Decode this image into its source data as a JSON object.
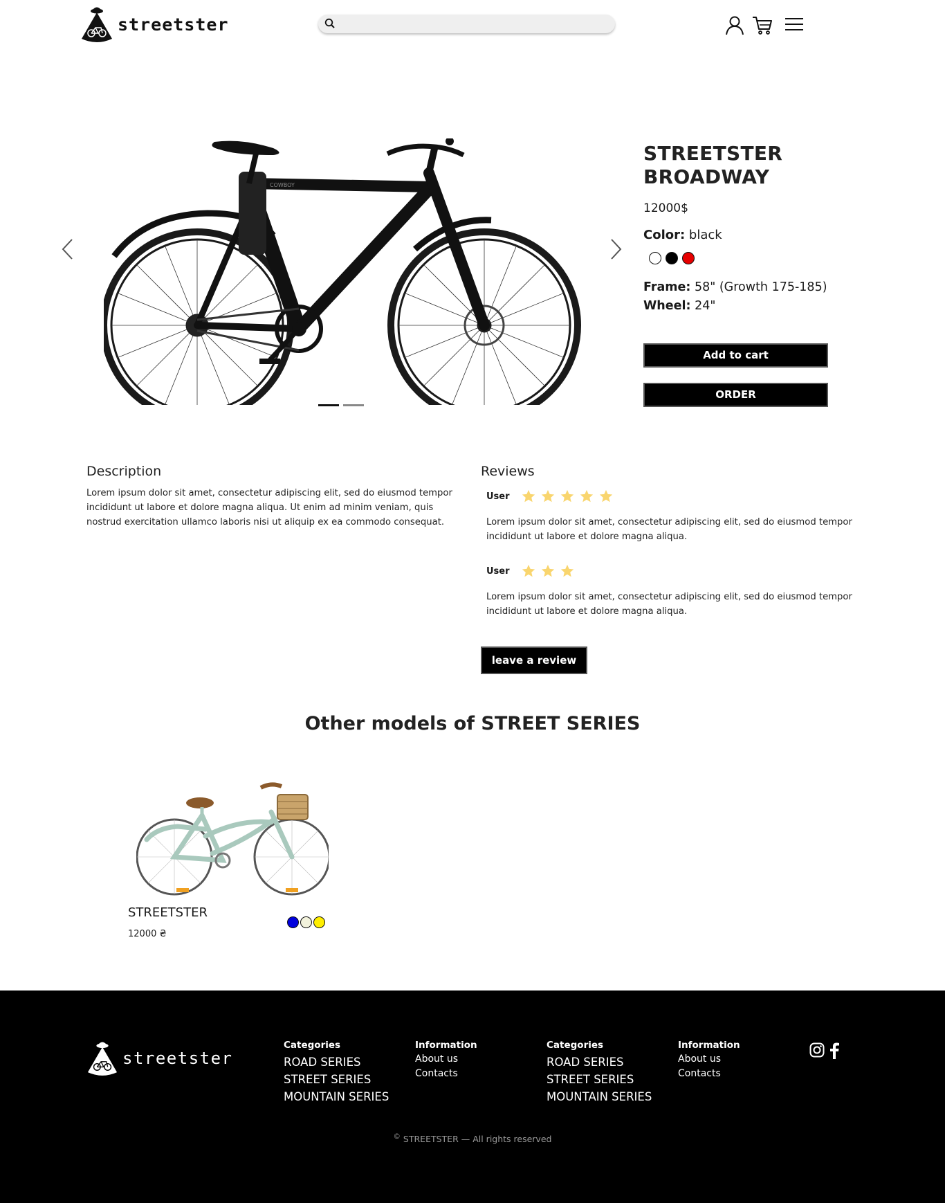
{
  "header": {
    "logo_text": "streetster",
    "search_placeholder": "",
    "icons": [
      "user-icon",
      "cart-icon",
      "menu-icon"
    ]
  },
  "product": {
    "title_line1": "STREETSTER",
    "title_line2": "BROADWAY",
    "price": "12000$",
    "color_label": "Color:",
    "color_value": "black",
    "swatches": [
      "#ffffff",
      "#000000",
      "#e60000"
    ],
    "frame_label": "Frame:",
    "frame_value": "58\" (Growth 175-185)",
    "wheel_label": "Wheel:",
    "wheel_value": "24\"",
    "add_to_cart": "Add to cart",
    "order": "ORDER",
    "bike_brand_text": "COWBOY"
  },
  "gallery": {
    "slides": 2,
    "active_slide": 1
  },
  "description": {
    "heading": "Description",
    "text": "Lorem ipsum dolor sit amet, consectetur adipiscing elit, sed do eiusmod tempor incididunt ut labore et dolore magna aliqua. Ut enim ad minim veniam, quis nostrud exercitation ullamco laboris nisi ut aliquip ex ea commodo consequat."
  },
  "reviews": {
    "heading": "Reviews",
    "items": [
      {
        "user": "User",
        "stars": 5,
        "text": "Lorem ipsum dolor sit amet, consectetur adipiscing elit, sed do eiusmod tempor incididunt ut labore et dolore magna aliqua."
      },
      {
        "user": "User",
        "stars": 3,
        "text": "Lorem ipsum dolor sit amet, consectetur adipiscing elit, sed do eiusmod tempor incididunt ut labore et dolore magna aliqua."
      }
    ],
    "leave_review": "leave a review",
    "star_color": "#f9d56e"
  },
  "other_models": {
    "heading": "Other models of STREET SERIES",
    "card": {
      "name": "STREETSTER",
      "price": "12000 ₴",
      "swatches": [
        "#0000dd",
        "#f2f2dc",
        "#ffee00"
      ]
    }
  },
  "footer": {
    "logo_text": "streetster",
    "col1": {
      "heading": "Categories",
      "items": [
        "ROAD SERIES",
        "STREET SERIES",
        "MOUNTAIN SERIES"
      ]
    },
    "col2": {
      "heading": "Information",
      "items": [
        "About us",
        "Contacts"
      ]
    },
    "col3": {
      "heading": "Categories",
      "items": [
        "ROAD SERIES",
        "STREET SERIES",
        "MOUNTAIN SERIES"
      ]
    },
    "col4": {
      "heading": "Information",
      "items": [
        "About us",
        "Contacts"
      ]
    },
    "copyright_symbol": "©",
    "copyright": "STREETSTER — All rights reserved",
    "social": [
      "instagram-icon",
      "facebook-icon"
    ]
  }
}
